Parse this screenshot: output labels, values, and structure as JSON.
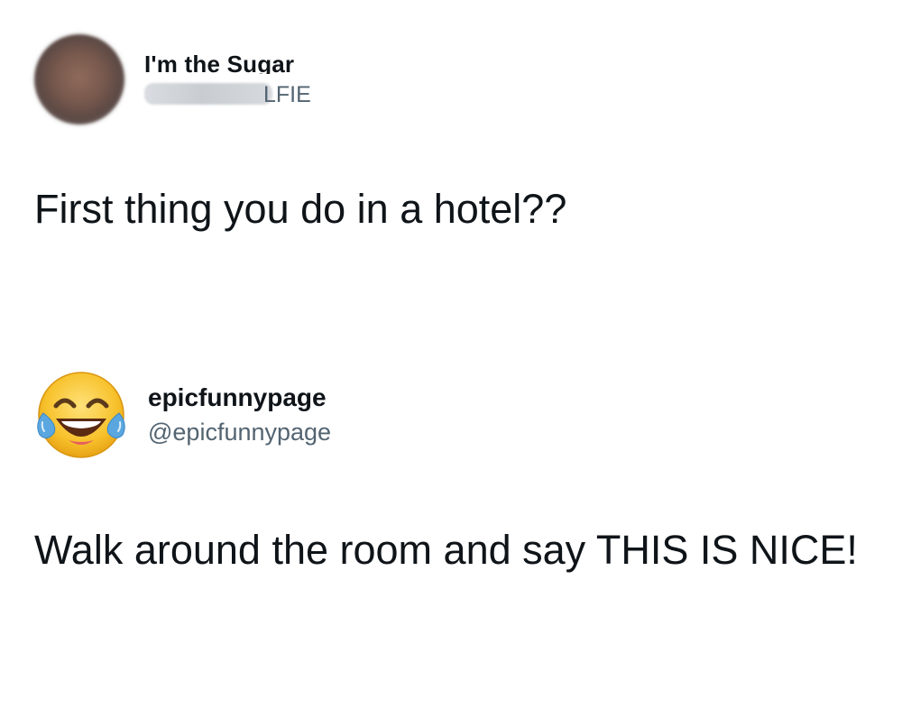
{
  "tweets": [
    {
      "display_name": "I'm the Sugar",
      "handle_visible": "LFIE",
      "text": "First thing you do in a hotel??",
      "avatar_icon": "blurred-profile-photo"
    },
    {
      "display_name": "epicfunnypage",
      "handle": "@epicfunnypage",
      "text": "Walk around the room and say THIS IS NICE!",
      "avatar_icon": "face-with-tears-of-joy-emoji"
    }
  ],
  "colors": {
    "background": "#ffffff",
    "primary_text": "#0f1419",
    "secondary_text": "#536471",
    "emoji_yellow": "#f7c12b",
    "emoji_tears": "#5aa7e0"
  }
}
